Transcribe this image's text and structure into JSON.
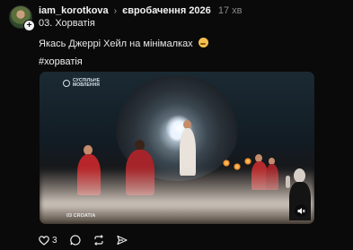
{
  "post": {
    "author": "iam_korotkova",
    "topic": "євробачення 2026",
    "time": "17 хв",
    "line1": "03. Хорватія",
    "line2": "Якась Джеррі Хейл на мінімалках",
    "hashtag": "#хорватія",
    "video": {
      "broadcaster_logo": "СУСПІЛЬНЕ МОВЛЕННЯ",
      "caption": "03 CROATIA"
    },
    "actions": {
      "likes": "3"
    }
  },
  "colors": {
    "background": "#0a0a0a",
    "text": "#f3f3f3",
    "muted": "#8b8b8b"
  }
}
